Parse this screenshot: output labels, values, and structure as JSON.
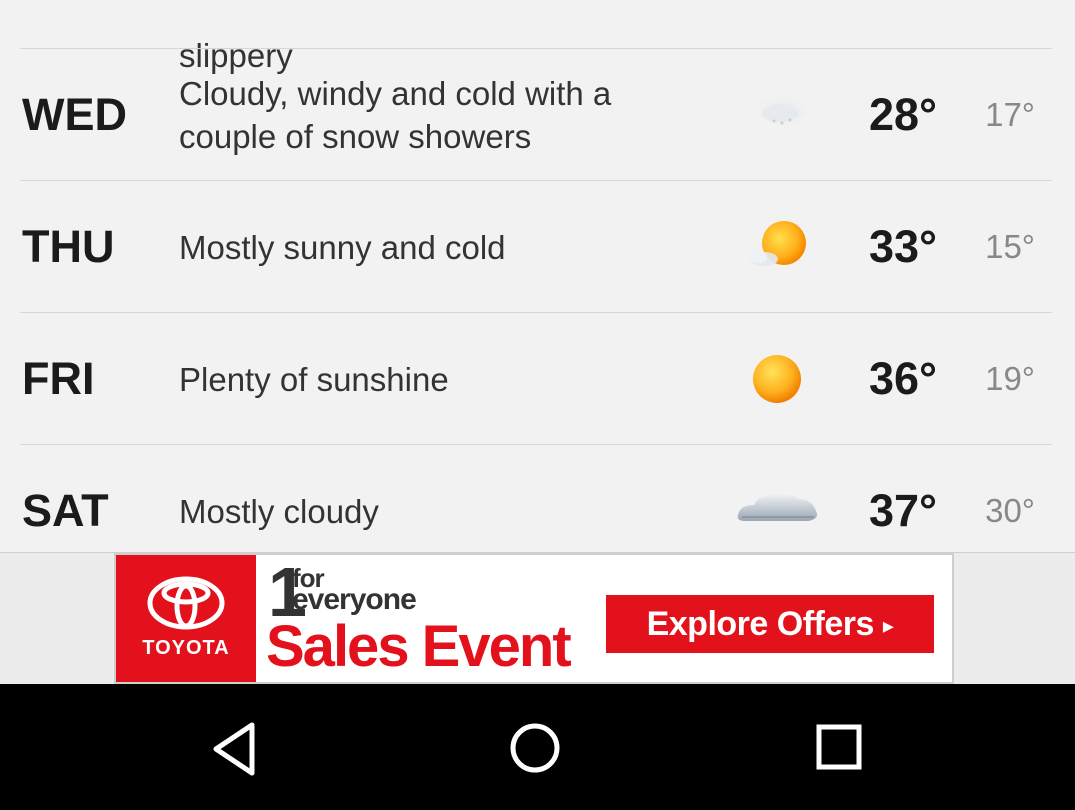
{
  "forecast": {
    "prev_description": "slippery",
    "days": [
      {
        "day": "WED",
        "description": "Cloudy, windy and cold with a couple of snow showers",
        "icon": "snow-shower-icon",
        "high": "28°",
        "low": "17°"
      },
      {
        "day": "THU",
        "description": "Mostly sunny and cold",
        "icon": "mostly-sunny-icon",
        "high": "33°",
        "low": "15°"
      },
      {
        "day": "FRI",
        "description": "Plenty of sunshine",
        "icon": "sunny-icon",
        "high": "36°",
        "low": "19°"
      },
      {
        "day": "SAT",
        "description": "Mostly cloudy",
        "icon": "mostly-cloudy-icon",
        "high": "37°",
        "low": "30°"
      }
    ]
  },
  "ad": {
    "brand": "TOYOTA",
    "number": "1",
    "tagline_for": "for",
    "tagline_everyone": "everyone",
    "title": "Sales Event",
    "button_label": "Explore Offers",
    "button_arrow": "▸",
    "colors": {
      "brand_red": "#e3111b"
    }
  },
  "navbar": {
    "icons": [
      "back-icon",
      "home-icon",
      "recents-icon"
    ]
  }
}
